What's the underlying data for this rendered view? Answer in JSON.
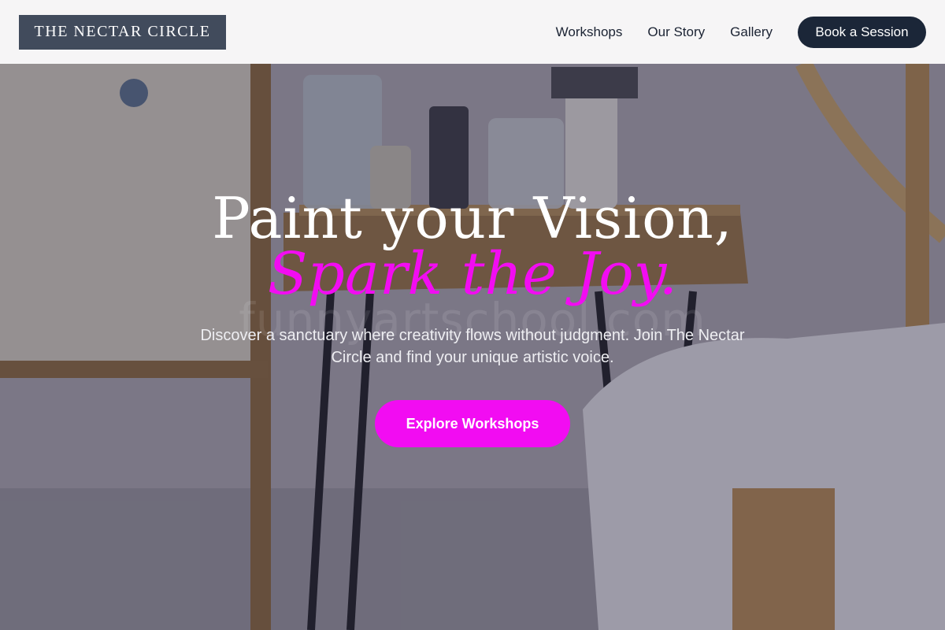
{
  "brand": {
    "logo_text": "THE NECTAR CIRCLE"
  },
  "nav": {
    "links": [
      "Workshops",
      "Our Story",
      "Gallery"
    ],
    "cta_label": "Book a Session"
  },
  "hero": {
    "title_line1": "Paint your Vision,",
    "title_line2": "Spark the Joy.",
    "subtitle": "Discover a sanctuary where creativity flows without judgment. Join The Nectar Circle and find your unique artistic voice.",
    "cta_label": "Explore Workshops"
  },
  "colors": {
    "accent": "#f20cf2",
    "dark": "#1b2638",
    "logo_bg": "#414b5c"
  }
}
